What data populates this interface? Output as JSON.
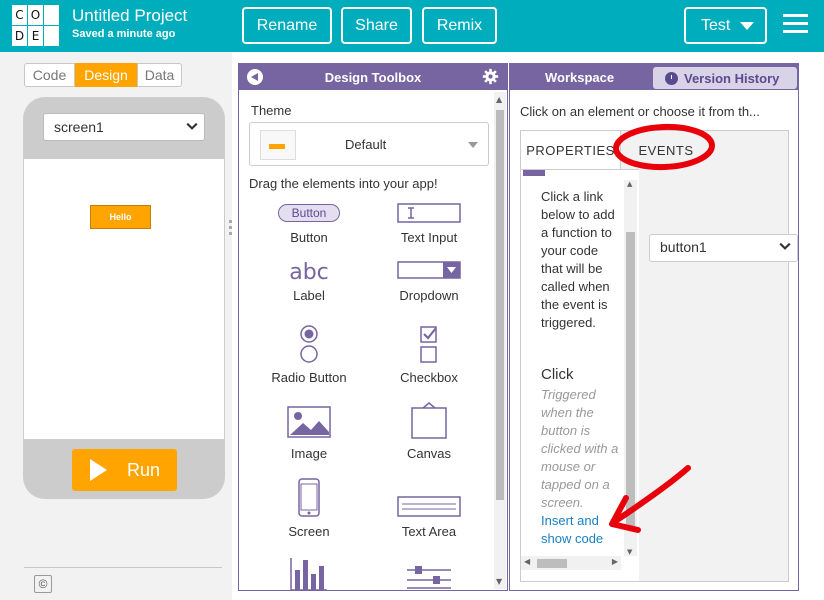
{
  "header": {
    "logo_letters": [
      "C",
      "O",
      "D",
      "E"
    ],
    "project_title": "Untitled Project",
    "saved_status": "Saved a minute ago",
    "rename_label": "Rename",
    "share_label": "Share",
    "remix_label": "Remix",
    "test_label": "Test",
    "menu_icon": "hamburger-icon"
  },
  "preview": {
    "modes": [
      "Code",
      "Design",
      "Data"
    ],
    "active_mode": "Design",
    "screen_select": "screen1",
    "hello_button": "Hello",
    "run_label": "Run",
    "copyright": "©"
  },
  "toolbox": {
    "title": "Design Toolbox",
    "theme_label": "Theme",
    "theme_value": "Default",
    "drag_label": "Drag the elements into your app!",
    "elements": [
      "Button",
      "Text Input",
      "Label",
      "Dropdown",
      "Radio Button",
      "Checkbox",
      "Image",
      "Canvas",
      "Screen",
      "Text Area"
    ],
    "button_preview_text": "Button",
    "label_preview_text": "abc"
  },
  "workspace": {
    "title": "Workspace",
    "version_history": "Version History",
    "hint": "Click on an element or choose it from th...",
    "tab_properties": "PROPERTIES",
    "tab_events": "EVENTS",
    "element_select": "button1",
    "events_description": "Click a link below to add a function to your code that will be called when the event is triggered.",
    "click_title": "Click",
    "click_description": "Triggered when the button is clicked with a mouse or tapped on a screen.",
    "insert_link": "Insert and show code"
  },
  "colors": {
    "topbar": "#00adbc",
    "accent_orange": "#ffa400",
    "purple": "#7665a0",
    "annotation_red": "#e8000b",
    "link_blue": "#1a7fc1"
  }
}
